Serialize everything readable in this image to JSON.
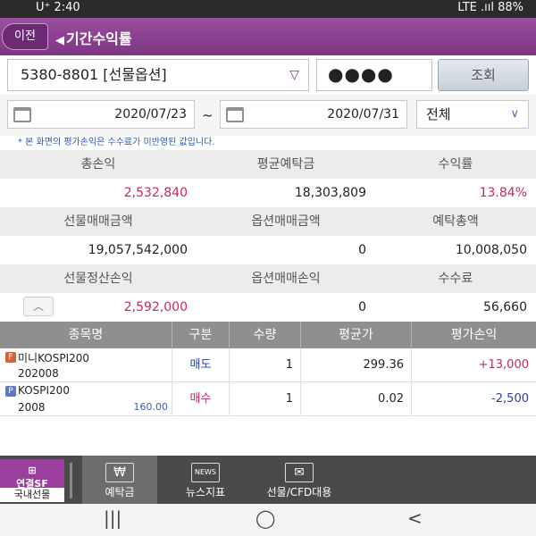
{
  "status": {
    "carrier": "U⁺ 2:40",
    "left_icons": "NEW Kὕ",
    "right_text": "LTE .ııl 88%"
  },
  "header": {
    "back_label": "이전",
    "title": "기간수익률"
  },
  "account": {
    "number": "5380-8801 [선물옵션]",
    "password": "●●●●",
    "query_label": "조회"
  },
  "filter": {
    "start_date": "2020/07/23",
    "separator": "~",
    "end_date": "2020/07/31",
    "type": "전체"
  },
  "note": "* 본 화면의 평가손익은 수수료가 미반영된 값입니다.",
  "summary": {
    "row1_headers": [
      "총손익",
      "평균예탁금",
      "수익률"
    ],
    "row1_values": [
      "2,532,840",
      "18,303,809",
      "13.84%"
    ],
    "row2_headers": [
      "선물매매금액",
      "옵션매매금액",
      "예탁총액"
    ],
    "row2_values": [
      "19,057,542,000",
      "0",
      "10,008,050"
    ],
    "row3_headers": [
      "선물정산손익",
      "옵션매매손익",
      "수수료"
    ],
    "row3_values": [
      "2,592,000",
      "0",
      "56,660"
    ],
    "collapse_icon": "chevron-up-icon"
  },
  "positions": {
    "headers": [
      "종목명",
      "구분",
      "수량",
      "평균가",
      "평가손익"
    ],
    "rows": [
      {
        "badge": "F",
        "name": "미니KOSPI200",
        "code": "202008",
        "extra": "",
        "side": "매도",
        "qty": "1",
        "avg": "299.36",
        "pnl": "+13,000"
      },
      {
        "badge": "P",
        "name": "KOSPI200",
        "code": "2008",
        "extra": "160.00",
        "side": "매수",
        "qty": "1",
        "avg": "0.02",
        "pnl": "-2,500"
      }
    ]
  },
  "nav": {
    "left_top": "연결SF",
    "left_bottom": "국내선물",
    "items": [
      {
        "label": "예탁금",
        "glyph": "₩",
        "icon": "won-icon"
      },
      {
        "label": "뉴스지표",
        "glyph": "NEWS",
        "icon": "news-icon"
      },
      {
        "label": "선물/CFD대용",
        "glyph": "✉",
        "icon": "cfd-icon"
      }
    ]
  },
  "system_nav": {
    "recent": "|||",
    "home": "◯",
    "back": "<"
  }
}
